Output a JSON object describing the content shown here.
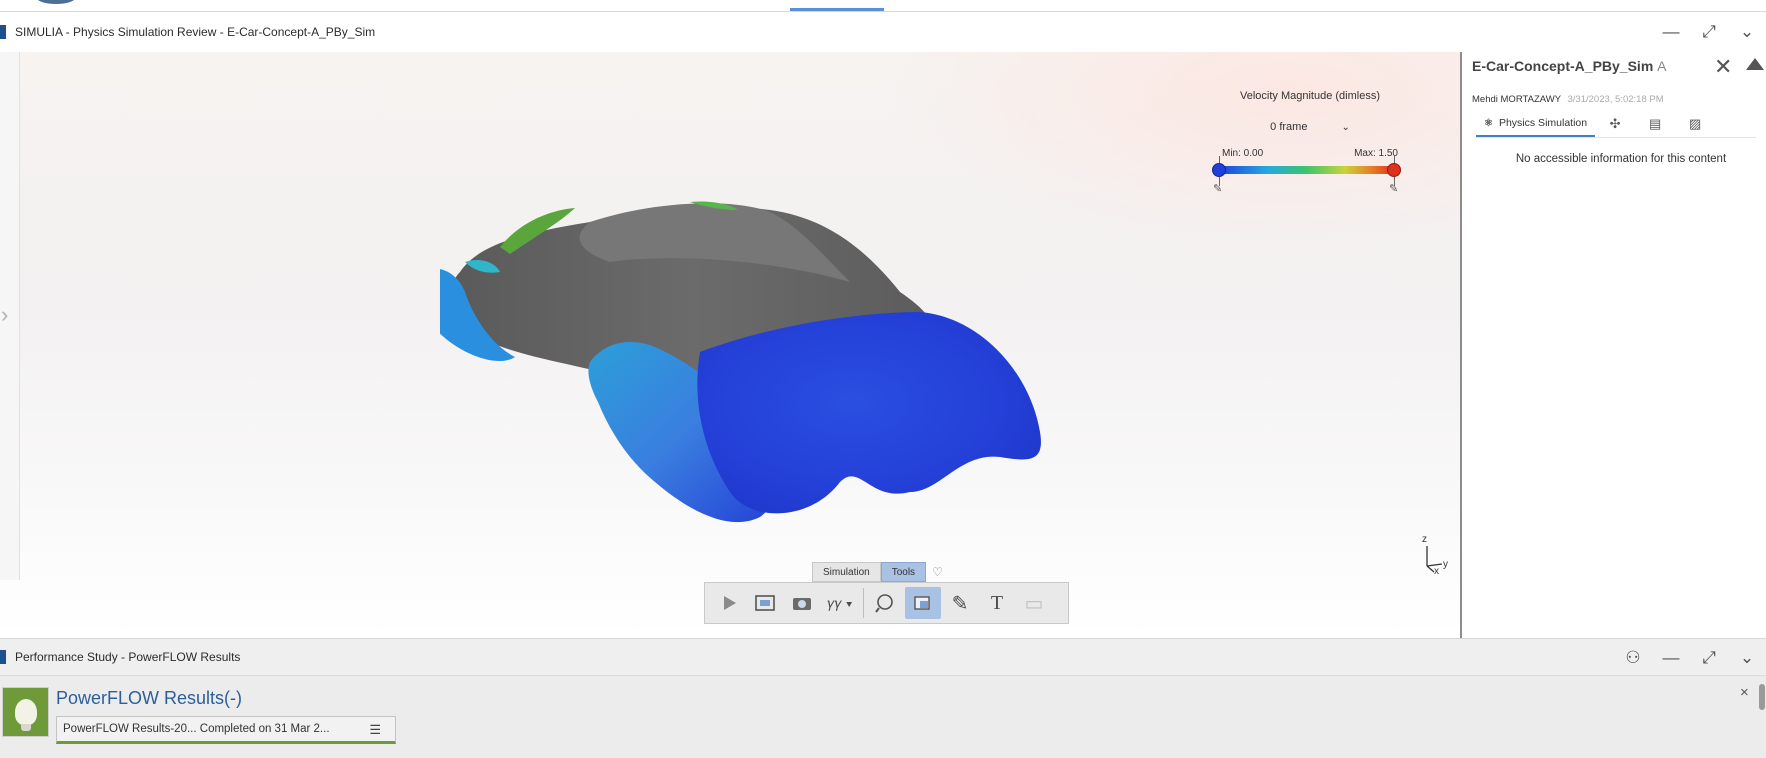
{
  "main_window": {
    "title": "SIMULIA - Physics Simulation Review - E-Car-Concept-A_PBy_Sim",
    "controls": {
      "minimize": "—",
      "maximize": "⤢",
      "more": "⌄"
    }
  },
  "viewport": {
    "legend": {
      "title": "Velocity Magnitude (dimless)",
      "frame_selected": "0 frame",
      "min_label": "Min: 0.00",
      "max_label": "Max: 1.50",
      "colors": [
        "#1e3fdc",
        "#27a8e0",
        "#3cc46c",
        "#c9d43a",
        "#e87a25",
        "#e0301e"
      ]
    },
    "axis_labels": {
      "z": "z",
      "y": "y",
      "x": "x"
    },
    "toolbar": {
      "tabs": [
        {
          "label": "Simulation",
          "active": false
        },
        {
          "label": "Tools",
          "active": true
        }
      ]
    }
  },
  "right_panel": {
    "title": "E-Car-Concept-A_PBy_Sim",
    "revision": "A",
    "author": "Mehdi MORTAZAWY",
    "date": "3/31/2023, 5:02:18 PM",
    "tabs": [
      {
        "icon": "physics-simulation-icon",
        "label": "Physics Simulation",
        "active": true
      },
      {
        "icon": "graph-icon",
        "active": false
      },
      {
        "icon": "table-icon",
        "active": false
      },
      {
        "icon": "comment-icon",
        "active": false
      }
    ],
    "info_text": "No accessible information for this content"
  },
  "bottom_panel": {
    "title": "Performance Study - PowerFLOW Results",
    "result_title": "PowerFLOW Results(-)",
    "result_row": "PowerFLOW Results-20... Completed on 31 Mar 2..."
  }
}
